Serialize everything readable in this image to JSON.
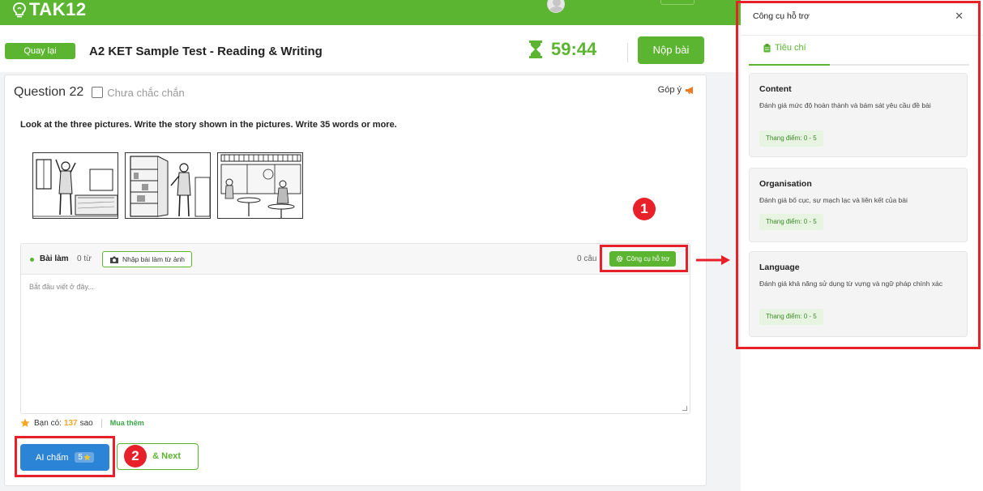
{
  "app": {
    "logo_tak": "TAK",
    "logo_k12": "12"
  },
  "header": {
    "back_label": "Quay lại",
    "test_title": "A2 KET Sample Test - Reading & Writing",
    "timer": "59:44",
    "submit_label": "Nộp bài"
  },
  "question": {
    "title": "Question 22",
    "unsure_label": "Chưa chắc chắn",
    "feedback_label": "Góp ý",
    "instruction": "Look at the three pictures.  Write the story shown in the pictures.  Write 35 words or more."
  },
  "answer": {
    "label": "Bài làm",
    "word_count": "0 từ",
    "photo_button": "Nhập bài làm từ ảnh",
    "sentence_count": "0 câu",
    "tools_button": "Công cụ hỗ trợ",
    "placeholder": "Bắt đầu viết ở đây..."
  },
  "stars": {
    "prefix": "Bạn có:",
    "count": "137",
    "suffix": "sao",
    "buy_label": "Mua thêm"
  },
  "actions": {
    "ai_grade_label": "AI chấm",
    "ai_cost": "5",
    "next_label": "& Next"
  },
  "annotations": {
    "marker1": "1",
    "marker2": "2",
    "highlight_color": "#e8202a"
  },
  "panel": {
    "title": "Công cụ hỗ trợ",
    "tab_label": "Tiêu chí",
    "criteria": [
      {
        "title": "Content",
        "description": "Đánh giá mức độ hoàn thành và bám sát yêu cầu đề bài",
        "scale": "Thang điểm: 0 - 5"
      },
      {
        "title": "Organisation",
        "description": "Đánh giá bố cục, sự mạch lạc và liên kết của bài",
        "scale": "Thang điểm: 0 - 5"
      },
      {
        "title": "Language",
        "description": "Đánh giá khả năng sử dụng từ vựng và ngữ pháp chính xác",
        "scale": "Thang điểm: 0 - 5"
      }
    ]
  },
  "colors": {
    "brand_green": "#5cb531",
    "ai_blue": "#2c84d6",
    "star_orange": "#f5a623"
  }
}
